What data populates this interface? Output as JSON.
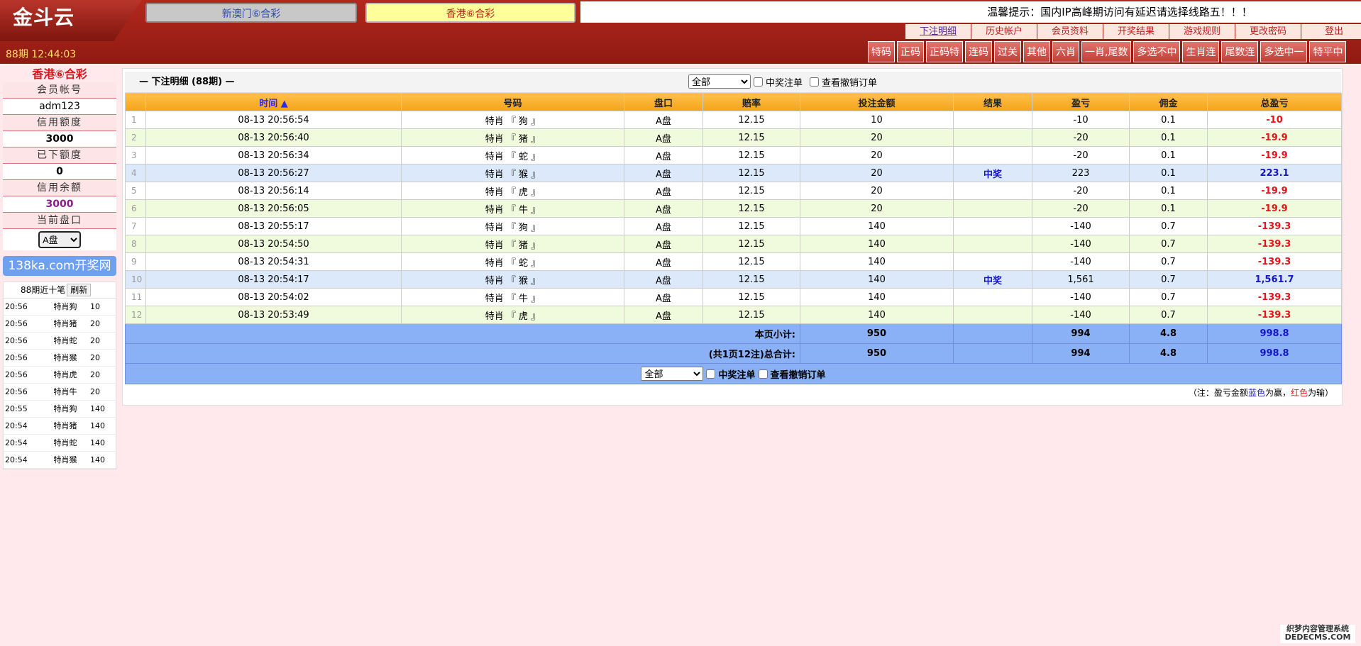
{
  "header": {
    "logo": "金斗云",
    "lottery_tabs": [
      "新澳门⑥合彩",
      "香港⑥合彩"
    ],
    "notice": "温馨提示：国内IP高峰期访问有延迟请选择线路五！！！",
    "top_nav": [
      "下注明细",
      "历史帐户",
      "会员资料",
      "开奖结果",
      "游戏规则",
      "更改密码",
      "登出"
    ],
    "period_time": "88期 12:44:03",
    "game_tabs": [
      "特码",
      "正码",
      "正码特",
      "连码",
      "过关",
      "其他",
      "六肖",
      "一肖,尾数",
      "多选不中",
      "生肖连",
      "尾数连",
      "多选中一",
      "特平中"
    ]
  },
  "sidebar": {
    "title": "香港⑥合彩",
    "account_label": "会员帐号",
    "account": "adm123",
    "credit_label": "信用额度",
    "credit": "3000",
    "used_label": "已下额度",
    "used": "0",
    "balance_label": "信用余额",
    "balance": "3000",
    "pan_label": "当前盘口",
    "pan_value": "A盘",
    "kaijiang": "138ka.com开奖网",
    "recent_title": "88期近十笔",
    "refresh": "刷新",
    "recent": [
      {
        "time": "20:56",
        "item": "特肖狗",
        "amt": "10"
      },
      {
        "time": "20:56",
        "item": "特肖猪",
        "amt": "20"
      },
      {
        "time": "20:56",
        "item": "特肖蛇",
        "amt": "20"
      },
      {
        "time": "20:56",
        "item": "特肖猴",
        "amt": "20"
      },
      {
        "time": "20:56",
        "item": "特肖虎",
        "amt": "20"
      },
      {
        "time": "20:56",
        "item": "特肖牛",
        "amt": "20"
      },
      {
        "time": "20:55",
        "item": "特肖狗",
        "amt": "140"
      },
      {
        "time": "20:54",
        "item": "特肖猪",
        "amt": "140"
      },
      {
        "time": "20:54",
        "item": "特肖蛇",
        "amt": "140"
      },
      {
        "time": "20:54",
        "item": "特肖猴",
        "amt": "140"
      }
    ]
  },
  "main": {
    "title": "— 下注明细 (88期) —",
    "filter_value": "全部",
    "win_only": "中奖注单",
    "cancelled": "查看撤销订单",
    "columns": [
      "时间 ▲",
      "号码",
      "盘口",
      "赔率",
      "投注金额",
      "结果",
      "盈亏",
      "佣金",
      "总盈亏"
    ],
    "rows": [
      {
        "idx": "1",
        "time": "08-13 20:56:54",
        "num": "特肖 『 狗 』",
        "pan": "A盘",
        "odds": "12.15",
        "amt": "10",
        "res": "",
        "pl": "-10",
        "comm": "0.1",
        "total": "-10"
      },
      {
        "idx": "2",
        "time": "08-13 20:56:40",
        "num": "特肖 『 猪 』",
        "pan": "A盘",
        "odds": "12.15",
        "amt": "20",
        "res": "",
        "pl": "-20",
        "comm": "0.1",
        "total": "-19.9"
      },
      {
        "idx": "3",
        "time": "08-13 20:56:34",
        "num": "特肖 『 蛇 』",
        "pan": "A盘",
        "odds": "12.15",
        "amt": "20",
        "res": "",
        "pl": "-20",
        "comm": "0.1",
        "total": "-19.9"
      },
      {
        "idx": "4",
        "time": "08-13 20:56:27",
        "num": "特肖 『 猴 』",
        "pan": "A盘",
        "odds": "12.15",
        "amt": "20",
        "res": "中奖",
        "pl": "223",
        "comm": "0.1",
        "total": "223.1"
      },
      {
        "idx": "5",
        "time": "08-13 20:56:14",
        "num": "特肖 『 虎 』",
        "pan": "A盘",
        "odds": "12.15",
        "amt": "20",
        "res": "",
        "pl": "-20",
        "comm": "0.1",
        "total": "-19.9"
      },
      {
        "idx": "6",
        "time": "08-13 20:56:05",
        "num": "特肖 『 牛 』",
        "pan": "A盘",
        "odds": "12.15",
        "amt": "20",
        "res": "",
        "pl": "-20",
        "comm": "0.1",
        "total": "-19.9"
      },
      {
        "idx": "7",
        "time": "08-13 20:55:17",
        "num": "特肖 『 狗 』",
        "pan": "A盘",
        "odds": "12.15",
        "amt": "140",
        "res": "",
        "pl": "-140",
        "comm": "0.7",
        "total": "-139.3"
      },
      {
        "idx": "8",
        "time": "08-13 20:54:50",
        "num": "特肖 『 猪 』",
        "pan": "A盘",
        "odds": "12.15",
        "amt": "140",
        "res": "",
        "pl": "-140",
        "comm": "0.7",
        "total": "-139.3"
      },
      {
        "idx": "9",
        "time": "08-13 20:54:31",
        "num": "特肖 『 蛇 』",
        "pan": "A盘",
        "odds": "12.15",
        "amt": "140",
        "res": "",
        "pl": "-140",
        "comm": "0.7",
        "total": "-139.3"
      },
      {
        "idx": "10",
        "time": "08-13 20:54:17",
        "num": "特肖 『 猴 』",
        "pan": "A盘",
        "odds": "12.15",
        "amt": "140",
        "res": "中奖",
        "pl": "1,561",
        "comm": "0.7",
        "total": "1,561.7"
      },
      {
        "idx": "11",
        "time": "08-13 20:54:02",
        "num": "特肖 『 牛 』",
        "pan": "A盘",
        "odds": "12.15",
        "amt": "140",
        "res": "",
        "pl": "-140",
        "comm": "0.7",
        "total": "-139.3"
      },
      {
        "idx": "12",
        "time": "08-13 20:53:49",
        "num": "特肖 『 虎 』",
        "pan": "A盘",
        "odds": "12.15",
        "amt": "140",
        "res": "",
        "pl": "-140",
        "comm": "0.7",
        "total": "-139.3"
      }
    ],
    "page_sum": {
      "label": "本页小计:",
      "amt": "950",
      "pl": "994",
      "comm": "4.8",
      "total": "998.8"
    },
    "grand_sum": {
      "label": "(共1页12注)总合计:",
      "amt": "950",
      "pl": "994",
      "comm": "4.8",
      "total": "998.8"
    },
    "note_prefix": "（注：盈亏金额",
    "note_blue": "蓝色",
    "note_mid": "为赢，",
    "note_red": "红色",
    "note_suffix": "为输）"
  },
  "watermark": {
    "line1": "织梦内容管理系统",
    "line2": "DEDECMS.COM"
  },
  "colors": {
    "header": "#a6221a",
    "table_head": "#ffb02e",
    "sum_row": "#8ab0f5",
    "win": "#1616c8",
    "loss": "#e8121a"
  }
}
